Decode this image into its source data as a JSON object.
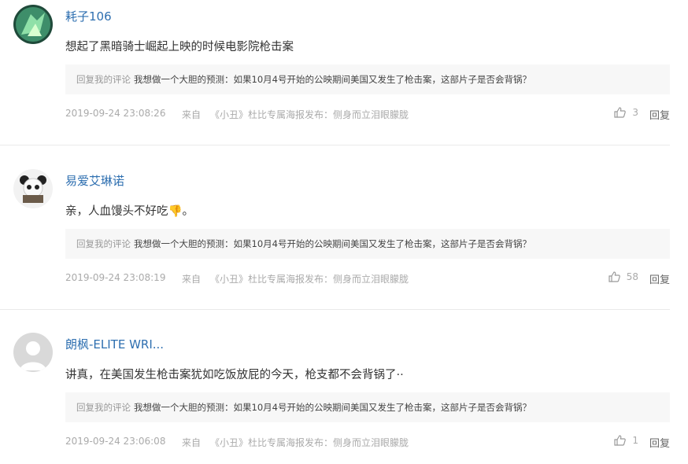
{
  "comments": [
    {
      "username": "耗子106",
      "text": "想起了黑暗骑士崛起上映的时候电影院枪击案",
      "quote_label": "回复我的评论",
      "quote_text": "我想做一个大胆的预测：如果10月4号开始的公映期间美国又发生了枪击案，这部片子是否会背锅？",
      "time": "2019-09-24 23:08:26",
      "from_label": "来自",
      "source": "《小丑》杜比专属海报发布：侧身而立泪眼朦胧",
      "likes": "3",
      "reply_label": "回复",
      "avatar": "green-avatar"
    },
    {
      "username": "易爱艾琳诺",
      "text": "亲，人血馒头不好吃👎。",
      "quote_label": "回复我的评论",
      "quote_text": "我想做一个大胆的预测：如果10月4号开始的公映期间美国又发生了枪击案，这部片子是否会背锅？",
      "time": "2019-09-24 23:08:19",
      "from_label": "来自",
      "source": "《小丑》杜比专属海报发布：侧身而立泪眼朦胧",
      "likes": "58",
      "reply_label": "回复",
      "avatar": "panda-avatar"
    },
    {
      "username": "朗枫-ELITE WRI...",
      "text": "讲真，在美国发生枪击案犹如吃饭放屁的今天，枪支都不会背锅了··",
      "quote_label": "回复我的评论",
      "quote_text": "我想做一个大胆的预测：如果10月4号开始的公映期间美国又发生了枪击案，这部片子是否会背锅？",
      "time": "2019-09-24 23:06:08",
      "from_label": "来自",
      "source": "《小丑》杜比专属海报发布：侧身而立泪眼朦胧",
      "likes": "1",
      "reply_label": "回复",
      "avatar": "default-avatar"
    }
  ],
  "colors": {
    "username": "#2e6fb0",
    "quote_bg": "#f7f7f7",
    "meta": "#aaaaaa"
  }
}
